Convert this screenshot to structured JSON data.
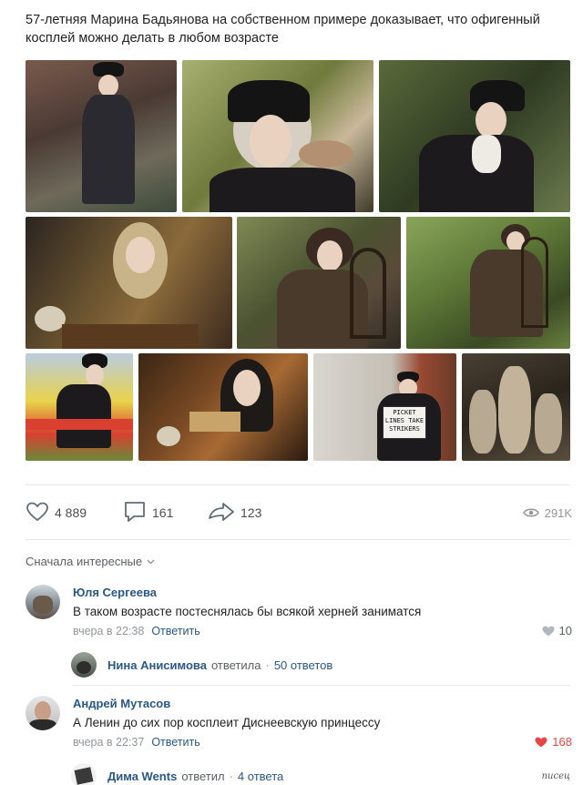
{
  "post": {
    "text": "57-летняя Марина Бадьянова на собственном примере доказывает, что офигенный косплей можно делать в любом возрасте",
    "photos": [
      {
        "label": "photo-1"
      },
      {
        "label": "photo-2"
      },
      {
        "label": "photo-3"
      },
      {
        "label": "photo-4"
      },
      {
        "label": "photo-5"
      },
      {
        "label": "photo-6"
      },
      {
        "label": "photo-7"
      },
      {
        "label": "photo-8"
      },
      {
        "label": "photo-9",
        "sign_text": "PICKET LINES TAKE STRIKERS"
      },
      {
        "label": "photo-10"
      }
    ]
  },
  "actions": {
    "likes": "4 889",
    "comments": "161",
    "shares": "123",
    "views": "291K"
  },
  "comments_section": {
    "sort_label": "Сначала интересные",
    "comments": [
      {
        "author": "Юля Сергеева",
        "text": "В таком возрасте постеснялась бы всякой херней заниматся",
        "time": "вчера в 22:38",
        "reply_label": "Ответить",
        "likes": "10",
        "liked": false,
        "thread": {
          "name": "Нина Анисимова",
          "verb": "ответила",
          "separator": "·",
          "count": "50 ответов"
        }
      },
      {
        "author": "Андрей Мутасов",
        "text": "А Ленин до сих пор косплеит Диснеевскую принцессу",
        "time": "вчера в 22:37",
        "reply_label": "Ответить",
        "likes": "168",
        "liked": true,
        "thread": {
          "name": "Дима Wents",
          "verb": "ответил",
          "separator": "·",
          "count": "4 ответа"
        }
      }
    ]
  },
  "watermark": "писец",
  "colors": {
    "link": "#2a5885",
    "muted": "#939699",
    "like_active": "#e64646",
    "icon": "#626d7a"
  }
}
